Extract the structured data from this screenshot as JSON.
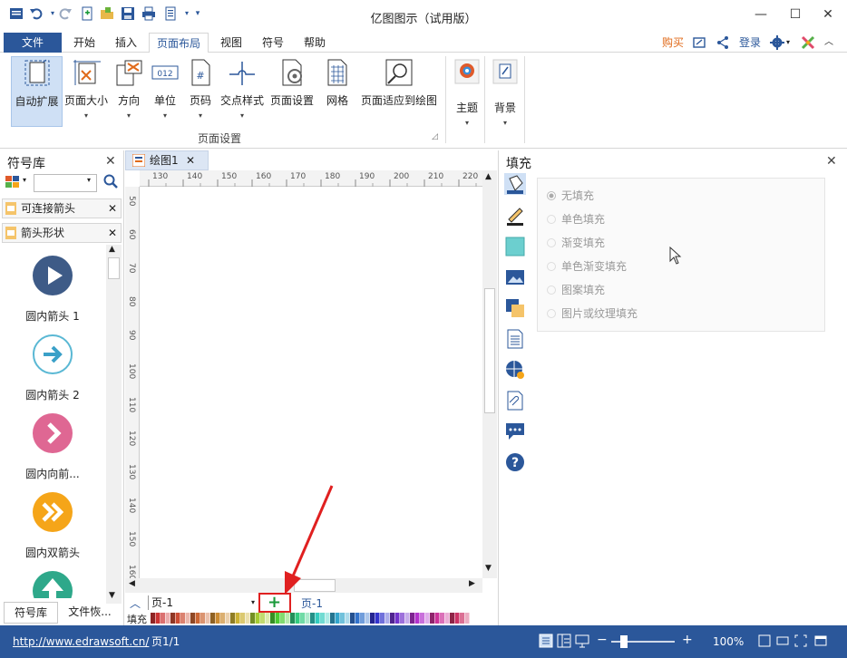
{
  "window": {
    "title": "亿图图示（试用版）",
    "controls": {
      "minimize": "—",
      "maximize": "☐",
      "close": "✕"
    }
  },
  "quick_access": [
    {
      "name": "app-menu-icon",
      "glyph": "☰"
    },
    {
      "name": "undo-icon",
      "glyph": "↶"
    },
    {
      "name": "redo-icon",
      "glyph": "↷"
    },
    {
      "name": "new-icon",
      "glyph": "✚"
    },
    {
      "name": "open-icon",
      "glyph": "📂"
    },
    {
      "name": "save-icon",
      "glyph": "💾"
    },
    {
      "name": "print-icon",
      "glyph": "🖶"
    },
    {
      "name": "export-icon",
      "glyph": "▤"
    },
    {
      "name": "customize-icon",
      "glyph": "▾"
    }
  ],
  "menu": {
    "file": "文件",
    "tabs": [
      "开始",
      "插入",
      "页面布局",
      "视图",
      "符号",
      "帮助"
    ],
    "active_tab": "页面布局",
    "buy": "购买",
    "login": "登录"
  },
  "ribbon": {
    "buttons": [
      {
        "label": "自动扩展",
        "dropdown": ""
      },
      {
        "label": "页面大小",
        "dropdown": "▾"
      },
      {
        "label": "方向",
        "dropdown": "▾"
      },
      {
        "label": "单位",
        "dropdown": "▾"
      },
      {
        "label": "页码",
        "dropdown": "▾"
      },
      {
        "label": "交点样式",
        "dropdown": "▾"
      },
      {
        "label": "页面设置",
        "dropdown": ""
      },
      {
        "label": "网格",
        "dropdown": ""
      },
      {
        "label": "页面适应到绘图",
        "dropdown": ""
      }
    ],
    "group_label": "页面设置",
    "theme_label": "主题",
    "background_label": "背景",
    "dropdown_glyph": "▾"
  },
  "library": {
    "title": "符号库",
    "search_placeholder": "",
    "sections": [
      "可连接箭头",
      "箭头形状"
    ],
    "shapes": [
      {
        "caption": "圆内箭头 1",
        "color": "#3e5b87",
        "glyph": "▶"
      },
      {
        "caption": "圆内箭头 2",
        "color": "#ffffff",
        "glyph": "➜"
      },
      {
        "caption": "圆内向前...",
        "color": "#df6793",
        "glyph": "❯"
      },
      {
        "caption": "圆内双箭头",
        "color": "#f5a519",
        "glyph": "»"
      },
      {
        "caption": "",
        "color": "#2ea88a",
        "glyph": "⬆"
      }
    ],
    "bottom_tabs": [
      "符号库",
      "文件恢..."
    ]
  },
  "document": {
    "tab": "绘图1",
    "hruler_ticks": [
      "130",
      "140",
      "150",
      "160",
      "170",
      "180",
      "190",
      "200",
      "210",
      "220"
    ],
    "vruler_ticks": [
      "50",
      "60",
      "70",
      "80",
      "90",
      "100",
      "110",
      "120",
      "130",
      "140",
      "150",
      "160"
    ],
    "page_select": "页-1",
    "add_page": "+",
    "page_tab": "页-1",
    "fill_label": "填充"
  },
  "fill_panel": {
    "title": "填充",
    "options": [
      "无填充",
      "单色填充",
      "渐变填充",
      "单色渐变填充",
      "图案填充",
      "图片或纹理填充"
    ],
    "selected": "无填充"
  },
  "status": {
    "url": "http://www.edrawsoft.cn/",
    "page": "页1/1",
    "zoom": "100%"
  },
  "colors": {
    "accent": "#2b579a",
    "annotation_red": "#e02020",
    "add_green": "#1a9a3a"
  }
}
